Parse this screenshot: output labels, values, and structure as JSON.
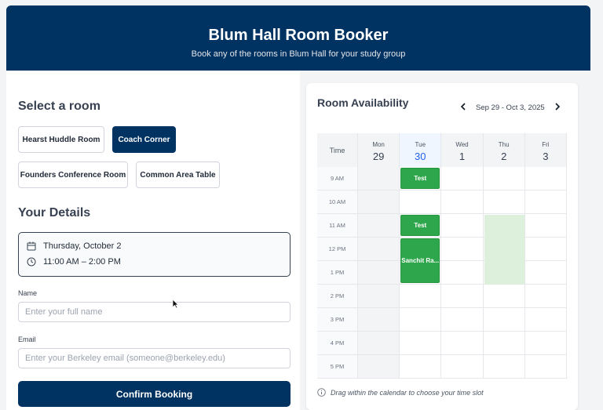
{
  "header": {
    "title": "Blum Hall Room Booker",
    "subtitle": "Book any of the rooms in Blum Hall for your study group"
  },
  "rooms": {
    "heading": "Select a room",
    "items": [
      {
        "label": "Hearst Huddle Room",
        "selected": false
      },
      {
        "label": "Coach Corner",
        "selected": true
      },
      {
        "label": "Founders Conference Room",
        "selected": false
      },
      {
        "label": "Common Area Table",
        "selected": false
      }
    ]
  },
  "details": {
    "heading": "Your Details",
    "date": "Thursday, October 2",
    "time": "11:00 AM – 2:00 PM",
    "name_label": "Name",
    "name_placeholder": "Enter your full name",
    "email_label": "Email",
    "email_placeholder": "Enter your Berkeley email (someone@berkeley.edu)",
    "confirm_label": "Confirm Booking"
  },
  "availability": {
    "title": "Room Availability",
    "range": "Sep 29 - Oct 3, 2025",
    "prev_icon": "chevron-left-icon",
    "next_icon": "chevron-right-icon",
    "time_header": "Time",
    "days": [
      {
        "dow": "Mon",
        "num": "29"
      },
      {
        "dow": "Tue",
        "num": "30"
      },
      {
        "dow": "Wed",
        "num": "1"
      },
      {
        "dow": "Thu",
        "num": "2"
      },
      {
        "dow": "Fri",
        "num": "3"
      }
    ],
    "times": [
      "9 AM",
      "10 AM",
      "11 AM",
      "12 PM",
      "1 PM",
      "2 PM",
      "3 PM",
      "4 PM",
      "5 PM"
    ],
    "events": [
      {
        "label": "Test",
        "day": 1,
        "start": 0,
        "span": 1
      },
      {
        "label": "Test",
        "day": 1,
        "start": 2,
        "span": 1
      },
      {
        "label": "Sanchit Ra...",
        "day": 1,
        "start": 3,
        "span": 2
      }
    ],
    "selection": {
      "day": 3,
      "start": 2,
      "span": 3
    },
    "hint": "Drag within the calendar to choose your time slot"
  },
  "colors": {
    "brand": "#003262",
    "event": "#2ea64b",
    "selection": "#dcf0dc",
    "today": "#2563eb"
  }
}
